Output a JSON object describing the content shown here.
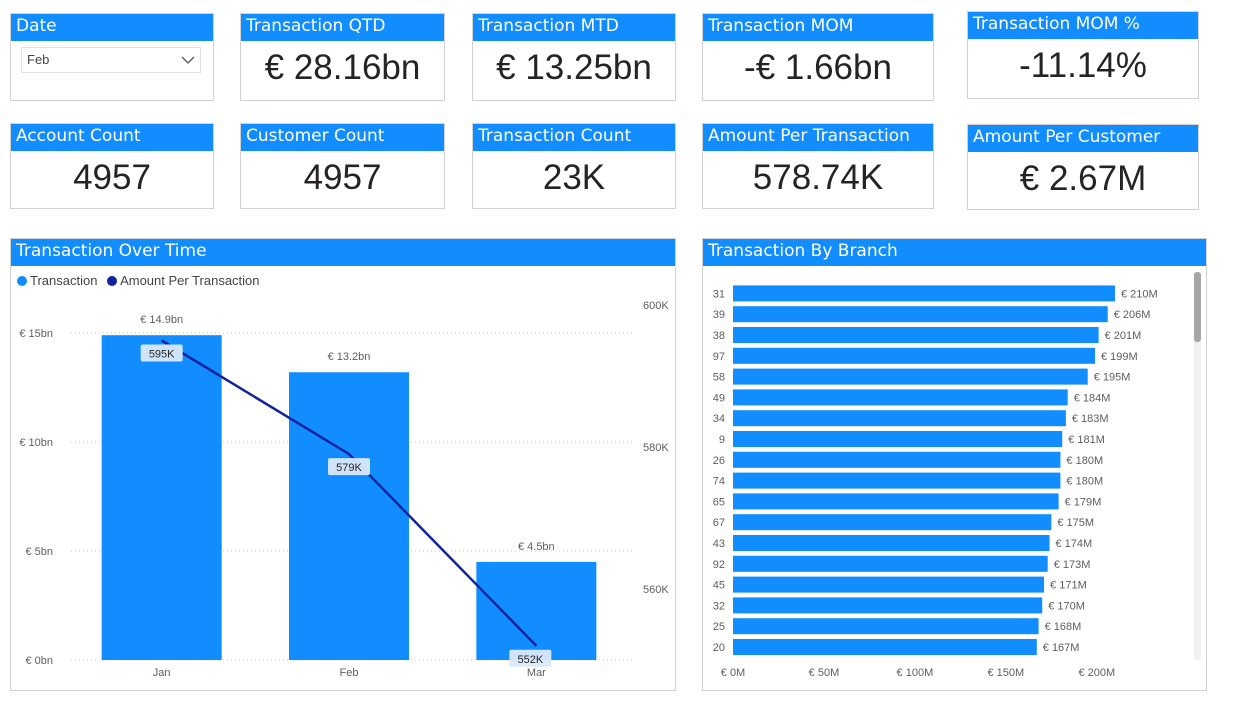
{
  "date_slicer": {
    "title": "Date",
    "selected": "Feb"
  },
  "kpis": [
    {
      "title": "Transaction QTD",
      "value": "€ 28.16bn"
    },
    {
      "title": "Transaction MTD",
      "value": "€ 13.25bn"
    },
    {
      "title": "Transaction MOM",
      "value": "-€ 1.66bn"
    },
    {
      "title": "Transaction MOM %",
      "value": "-11.14%"
    },
    {
      "title": "Account Count",
      "value": "4957"
    },
    {
      "title": "Customer Count",
      "value": "4957"
    },
    {
      "title": "Transaction Count",
      "value": "23K"
    },
    {
      "title": "Amount Per Transaction",
      "value": "578.74K"
    },
    {
      "title": "Amount Per Customer",
      "value": "€ 2.67M"
    }
  ],
  "colors": {
    "accent": "#118dff",
    "line": "#12239e",
    "grid": "#c8c8c8"
  },
  "chart_data": [
    {
      "type": "bar",
      "title": "Transaction Over Time",
      "categories": [
        "Jan",
        "Feb",
        "Mar"
      ],
      "series": [
        {
          "name": "Transaction",
          "values": [
            14.9,
            13.2,
            4.5
          ],
          "labels": [
            "€ 14.9bn",
            "€ 13.2bn",
            "€ 4.5bn"
          ],
          "color": "#118dff"
        },
        {
          "name": "Amount Per Transaction",
          "type": "line",
          "axis": "right",
          "values": [
            595,
            579,
            552
          ],
          "labels": [
            "595K",
            "579K",
            "552K"
          ],
          "color": "#12239e"
        }
      ],
      "y_ticks": [
        "€ 0bn",
        "€ 5bn",
        "€ 10bn",
        "€ 15bn"
      ],
      "y_tick_values": [
        0,
        5,
        10,
        15
      ],
      "ylim": [
        0,
        15
      ],
      "y2_ticks": [
        "560K",
        "580K",
        "600K"
      ],
      "y2_tick_values": [
        560,
        580,
        600
      ],
      "y2lim": [
        550,
        600
      ],
      "grid": true,
      "legend": "top-left"
    },
    {
      "type": "bar",
      "orientation": "horizontal",
      "title": "Transaction By Branch",
      "categories": [
        "31",
        "39",
        "38",
        "97",
        "58",
        "49",
        "34",
        "9",
        "26",
        "74",
        "65",
        "67",
        "43",
        "92",
        "45",
        "32",
        "25",
        "20"
      ],
      "values": [
        210,
        206,
        201,
        199,
        195,
        184,
        183,
        181,
        180,
        180,
        179,
        175,
        174,
        173,
        171,
        170,
        168,
        167
      ],
      "labels": [
        "€ 210M",
        "€ 206M",
        "€ 201M",
        "€ 199M",
        "€ 195M",
        "€ 184M",
        "€ 183M",
        "€ 181M",
        "€ 180M",
        "€ 180M",
        "€ 179M",
        "€ 175M",
        "€ 174M",
        "€ 173M",
        "€ 171M",
        "€ 170M",
        "€ 168M",
        "€ 167M"
      ],
      "x_ticks": [
        "€ 0M",
        "€ 50M",
        "€ 100M",
        "€ 150M",
        "€ 200M"
      ],
      "x_tick_values": [
        0,
        50,
        100,
        150,
        200
      ],
      "xlim": [
        0,
        210
      ],
      "color": "#118dff"
    }
  ]
}
